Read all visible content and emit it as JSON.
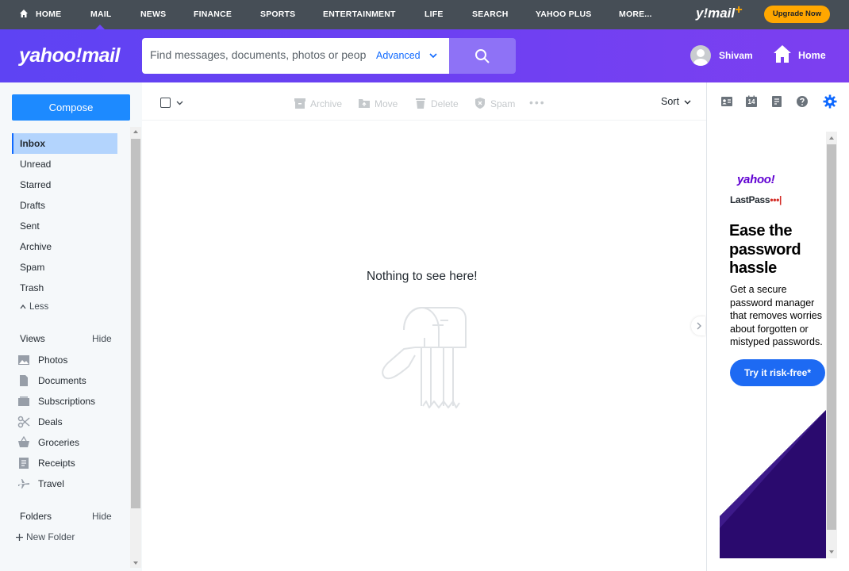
{
  "topnav": {
    "items": [
      "HOME",
      "MAIL",
      "NEWS",
      "FINANCE",
      "SPORTS",
      "ENTERTAINMENT",
      "LIFE",
      "SEARCH",
      "YAHOO PLUS",
      "MORE..."
    ],
    "brand": "y!mail",
    "brand_plus": "+",
    "upgrade": "Upgrade Now",
    "active": "MAIL"
  },
  "header": {
    "logo": "yahoo!mail",
    "search_placeholder": "Find messages, documents, photos or people",
    "advanced": "Advanced",
    "user_name": "Shivam",
    "home": "Home"
  },
  "sidebar": {
    "compose": "Compose",
    "folders": [
      "Inbox",
      "Unread",
      "Starred",
      "Drafts",
      "Sent",
      "Archive",
      "Spam",
      "Trash"
    ],
    "active_folder": "Inbox",
    "less": "Less",
    "views_label": "Views",
    "views_hide": "Hide",
    "views": [
      "Photos",
      "Documents",
      "Subscriptions",
      "Deals",
      "Groceries",
      "Receipts",
      "Travel"
    ],
    "folders_label": "Folders",
    "folders_hide": "Hide",
    "new_folder": "New Folder"
  },
  "toolbar": {
    "archive": "Archive",
    "move": "Move",
    "delete": "Delete",
    "spam": "Spam",
    "more": "•••",
    "sort": "Sort"
  },
  "main": {
    "empty_message": "Nothing to see here!"
  },
  "ad": {
    "brand1": "yahoo!",
    "brand2_a": "LastPass",
    "brand2_b": "•••|",
    "title": "Ease the password hassle",
    "body": "Get a secure password manager that removes worries about forgotten or mistyped passwords.",
    "cta": "Try it risk-free*"
  },
  "rightrail": {
    "calendar_day": "14",
    "icons": [
      "contacts-icon",
      "calendar-icon",
      "notepad-icon",
      "help-icon",
      "settings-icon"
    ]
  },
  "colors": {
    "accent": "#0f69ff",
    "header_purple": "#6e46fa",
    "compose_blue": "#1d8aff",
    "upgrade_orange": "#ffa700"
  }
}
